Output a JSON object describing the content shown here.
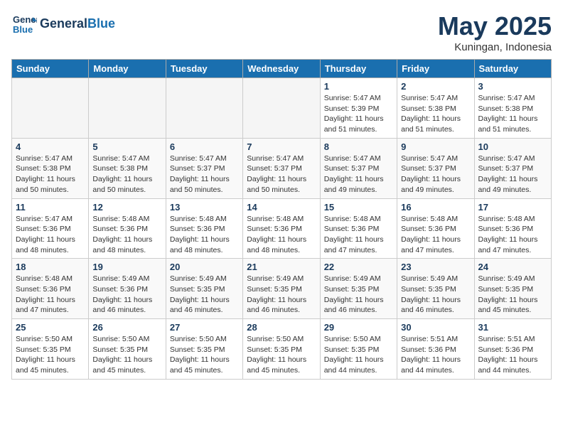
{
  "header": {
    "logo_line1": "General",
    "logo_line2": "Blue",
    "month": "May 2025",
    "location": "Kuningan, Indonesia"
  },
  "weekdays": [
    "Sunday",
    "Monday",
    "Tuesday",
    "Wednesday",
    "Thursday",
    "Friday",
    "Saturday"
  ],
  "weeks": [
    [
      {
        "day": "",
        "info": ""
      },
      {
        "day": "",
        "info": ""
      },
      {
        "day": "",
        "info": ""
      },
      {
        "day": "",
        "info": ""
      },
      {
        "day": "1",
        "info": "Sunrise: 5:47 AM\nSunset: 5:39 PM\nDaylight: 11 hours\nand 51 minutes."
      },
      {
        "day": "2",
        "info": "Sunrise: 5:47 AM\nSunset: 5:38 PM\nDaylight: 11 hours\nand 51 minutes."
      },
      {
        "day": "3",
        "info": "Sunrise: 5:47 AM\nSunset: 5:38 PM\nDaylight: 11 hours\nand 51 minutes."
      }
    ],
    [
      {
        "day": "4",
        "info": "Sunrise: 5:47 AM\nSunset: 5:38 PM\nDaylight: 11 hours\nand 50 minutes."
      },
      {
        "day": "5",
        "info": "Sunrise: 5:47 AM\nSunset: 5:38 PM\nDaylight: 11 hours\nand 50 minutes."
      },
      {
        "day": "6",
        "info": "Sunrise: 5:47 AM\nSunset: 5:37 PM\nDaylight: 11 hours\nand 50 minutes."
      },
      {
        "day": "7",
        "info": "Sunrise: 5:47 AM\nSunset: 5:37 PM\nDaylight: 11 hours\nand 50 minutes."
      },
      {
        "day": "8",
        "info": "Sunrise: 5:47 AM\nSunset: 5:37 PM\nDaylight: 11 hours\nand 49 minutes."
      },
      {
        "day": "9",
        "info": "Sunrise: 5:47 AM\nSunset: 5:37 PM\nDaylight: 11 hours\nand 49 minutes."
      },
      {
        "day": "10",
        "info": "Sunrise: 5:47 AM\nSunset: 5:37 PM\nDaylight: 11 hours\nand 49 minutes."
      }
    ],
    [
      {
        "day": "11",
        "info": "Sunrise: 5:47 AM\nSunset: 5:36 PM\nDaylight: 11 hours\nand 48 minutes."
      },
      {
        "day": "12",
        "info": "Sunrise: 5:48 AM\nSunset: 5:36 PM\nDaylight: 11 hours\nand 48 minutes."
      },
      {
        "day": "13",
        "info": "Sunrise: 5:48 AM\nSunset: 5:36 PM\nDaylight: 11 hours\nand 48 minutes."
      },
      {
        "day": "14",
        "info": "Sunrise: 5:48 AM\nSunset: 5:36 PM\nDaylight: 11 hours\nand 48 minutes."
      },
      {
        "day": "15",
        "info": "Sunrise: 5:48 AM\nSunset: 5:36 PM\nDaylight: 11 hours\nand 47 minutes."
      },
      {
        "day": "16",
        "info": "Sunrise: 5:48 AM\nSunset: 5:36 PM\nDaylight: 11 hours\nand 47 minutes."
      },
      {
        "day": "17",
        "info": "Sunrise: 5:48 AM\nSunset: 5:36 PM\nDaylight: 11 hours\nand 47 minutes."
      }
    ],
    [
      {
        "day": "18",
        "info": "Sunrise: 5:48 AM\nSunset: 5:36 PM\nDaylight: 11 hours\nand 47 minutes."
      },
      {
        "day": "19",
        "info": "Sunrise: 5:49 AM\nSunset: 5:36 PM\nDaylight: 11 hours\nand 46 minutes."
      },
      {
        "day": "20",
        "info": "Sunrise: 5:49 AM\nSunset: 5:35 PM\nDaylight: 11 hours\nand 46 minutes."
      },
      {
        "day": "21",
        "info": "Sunrise: 5:49 AM\nSunset: 5:35 PM\nDaylight: 11 hours\nand 46 minutes."
      },
      {
        "day": "22",
        "info": "Sunrise: 5:49 AM\nSunset: 5:35 PM\nDaylight: 11 hours\nand 46 minutes."
      },
      {
        "day": "23",
        "info": "Sunrise: 5:49 AM\nSunset: 5:35 PM\nDaylight: 11 hours\nand 46 minutes."
      },
      {
        "day": "24",
        "info": "Sunrise: 5:49 AM\nSunset: 5:35 PM\nDaylight: 11 hours\nand 45 minutes."
      }
    ],
    [
      {
        "day": "25",
        "info": "Sunrise: 5:50 AM\nSunset: 5:35 PM\nDaylight: 11 hours\nand 45 minutes."
      },
      {
        "day": "26",
        "info": "Sunrise: 5:50 AM\nSunset: 5:35 PM\nDaylight: 11 hours\nand 45 minutes."
      },
      {
        "day": "27",
        "info": "Sunrise: 5:50 AM\nSunset: 5:35 PM\nDaylight: 11 hours\nand 45 minutes."
      },
      {
        "day": "28",
        "info": "Sunrise: 5:50 AM\nSunset: 5:35 PM\nDaylight: 11 hours\nand 45 minutes."
      },
      {
        "day": "29",
        "info": "Sunrise: 5:50 AM\nSunset: 5:35 PM\nDaylight: 11 hours\nand 44 minutes."
      },
      {
        "day": "30",
        "info": "Sunrise: 5:51 AM\nSunset: 5:36 PM\nDaylight: 11 hours\nand 44 minutes."
      },
      {
        "day": "31",
        "info": "Sunrise: 5:51 AM\nSunset: 5:36 PM\nDaylight: 11 hours\nand 44 minutes."
      }
    ]
  ]
}
